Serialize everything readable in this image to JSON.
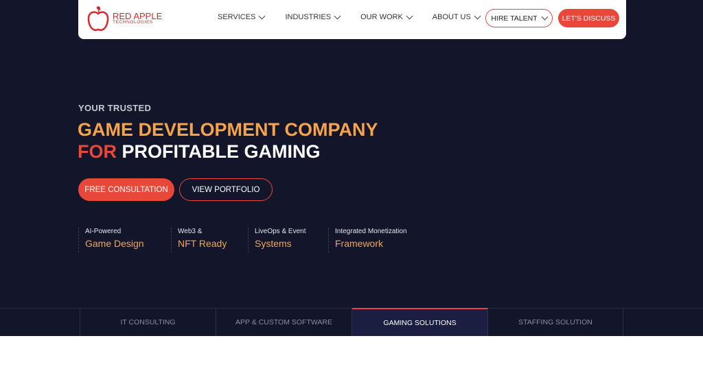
{
  "nav": {
    "logo": {
      "name": "RED APPLE",
      "sub": "TECHNOLOGIES"
    },
    "menu": [
      "SERVICES",
      "INDUSTRIES",
      "OUR WORK",
      "ABOUT US"
    ],
    "hire_talent": "HIRE TALENT",
    "lets_discuss": "LET'S DISCUSS"
  },
  "hero": {
    "eyebrow": "YOUR TRUSTED",
    "line1": "GAME DEVELOPMENT COMPANY",
    "for": "FOR",
    "line2": "PROFITABLE GAMING",
    "cta_primary": "FREE CONSULTATION",
    "cta_secondary": "VIEW PORTFOLIO",
    "features": [
      {
        "small": "AI-Powered",
        "large": "Game Design"
      },
      {
        "small": "Web3 &",
        "large": "NFT Ready"
      },
      {
        "small": "LiveOps & Event",
        "large": "Systems"
      },
      {
        "small": "Integrated Monetization",
        "large": "Framework"
      }
    ]
  },
  "tabs": [
    "IT CONSULTING",
    "APP & CUSTOM SOFTWARE",
    "GAMING SOLUTIONS",
    "STAFFING SOLUTION"
  ],
  "colors": {
    "accent": "#e8473a",
    "orange": "#f5a44b",
    "bg": "#13152b"
  }
}
